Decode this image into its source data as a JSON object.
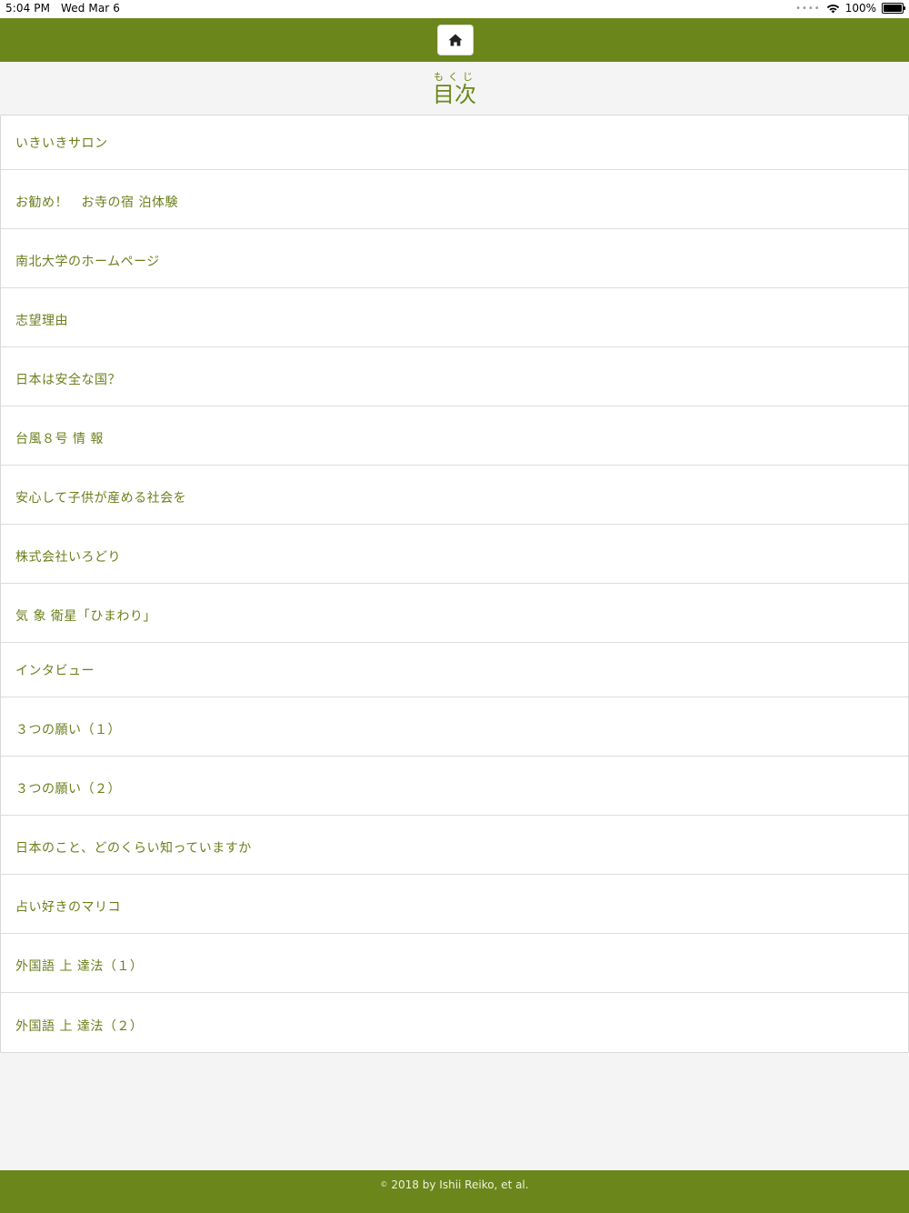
{
  "status": {
    "time": "5:04 PM",
    "date": "Wed Mar 6",
    "battery": "100%"
  },
  "header": {
    "home_icon": "home-icon"
  },
  "page": {
    "title": "目次",
    "title_reading": "もくじ"
  },
  "items": [
    "いきいきサロン",
    "お勧め！　お寺の宿 泊体験",
    "南北大学のホームページ",
    "志望理由",
    "日本は安全な国？",
    "台風８号 情 報",
    "安心して子供が産める社会を",
    "株式会社いろどり",
    "気 象 衛星「ひまわり」",
    "インタビュー",
    "３つの願い（１）",
    "３つの願い（２）",
    "日本のこと、どのくらい知っていますか",
    "占い好きのマリコ",
    "外国語 上 達法（１）",
    "外国語 上 達法（２）"
  ],
  "footer": {
    "copyright_symbol": "©",
    "text": "2018 by Ishii Reiko, et al."
  },
  "colors": {
    "brand": "#6b861b",
    "text": "#6b7f1c",
    "background": "#f4f4f4"
  }
}
